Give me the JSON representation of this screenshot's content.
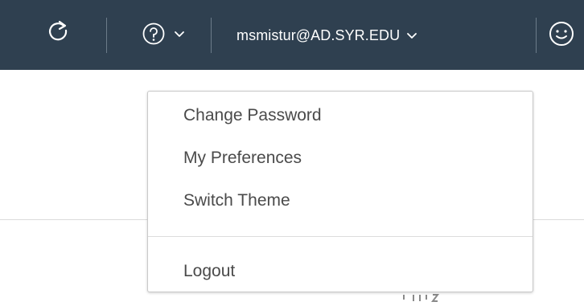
{
  "header": {
    "icons": {
      "refresh": "refresh-icon",
      "help": "help-icon",
      "chevron": "chevron-down-icon",
      "avatar": "user-avatar-icon"
    },
    "user_label": "msmistur@AD.SYR.EDU",
    "background_color": "#2f4050"
  },
  "dropdown": {
    "items": [
      {
        "label": "Change Password"
      },
      {
        "label": "My Preferences"
      },
      {
        "label": "Switch Theme"
      },
      {
        "label": "Logout"
      }
    ]
  }
}
